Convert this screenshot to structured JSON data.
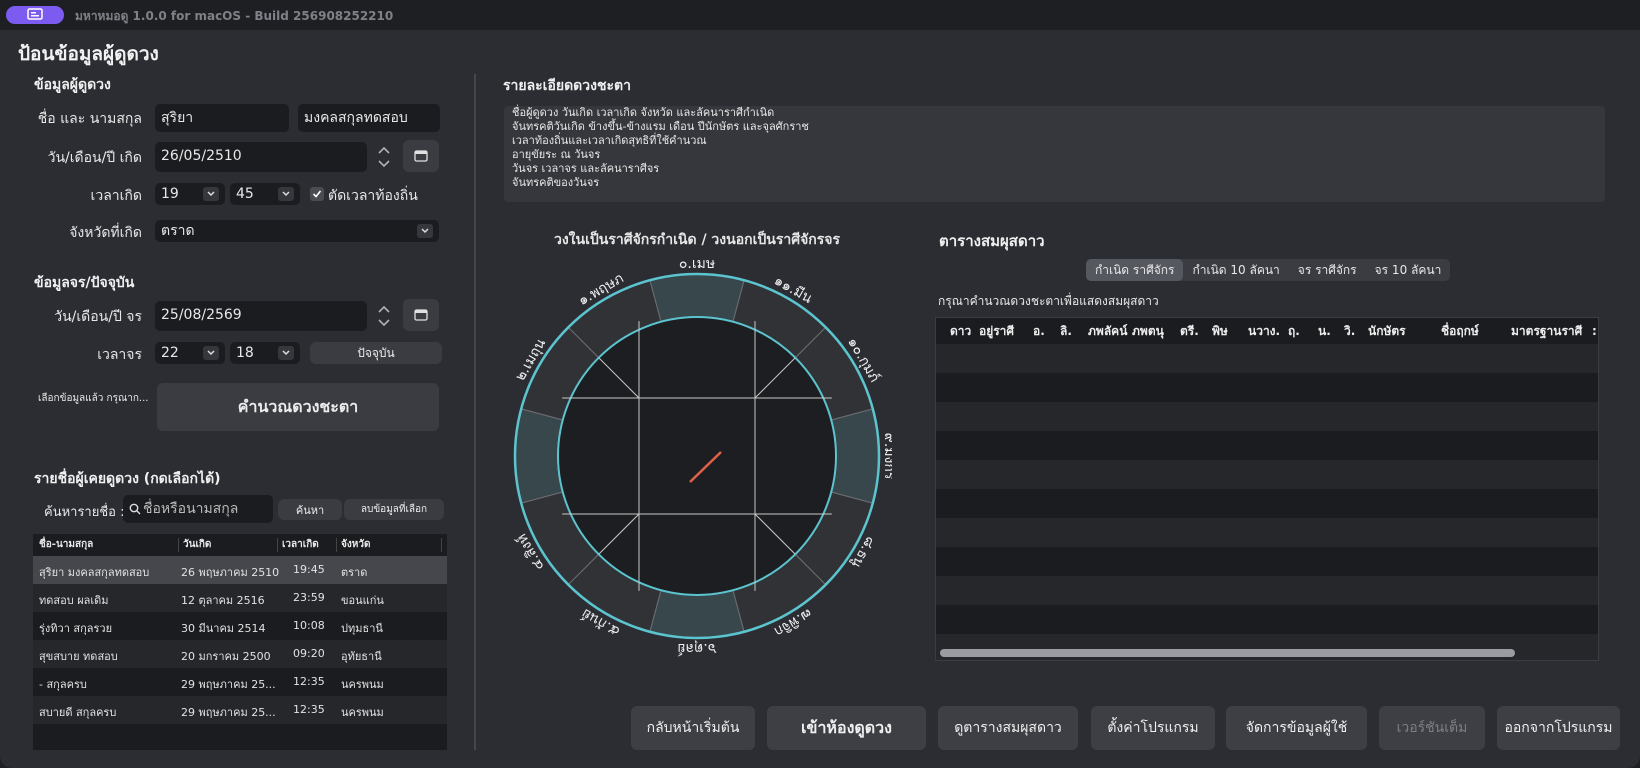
{
  "window": {
    "title": "มหาหมอดู 1.0.0 for macOS - Build 256908252210"
  },
  "page_title": "ป้อนข้อมูลผู้ดูดวง",
  "person": {
    "section": "ข้อมูลผู้ดูดวง",
    "name_label": "ชื่อ และ นามสกุล",
    "first_name": "สุริยา",
    "last_name": "มงคลสกุลทดสอบ",
    "dob_label": "วัน/เดือน/ปี เกิด",
    "dob": "26/05/2510",
    "time_label": "เวลาเกิด",
    "hour": "19",
    "minute": "45",
    "local_time_label": "ตัดเวลาท้องถิ่น",
    "province_label": "จังหวัดที่เกิด",
    "province": "ตราด"
  },
  "transit": {
    "section": "ข้อมูลจร/ปัจจุบัน",
    "date_label": "วัน/เดือน/ปี จร",
    "date": "25/08/2569",
    "time_label": "เวลาจร",
    "hour": "22",
    "minute": "18",
    "now_label": "ปัจจุบัน"
  },
  "hint": "เลือกข้อมูลแล้ว กรุณาก...",
  "calc_button": "คำนวณดวงชะตา",
  "history": {
    "title": "รายชื่อผู้เคยดูดวง (กดเลือกได้)",
    "search_label": "ค้นหารายชื่อ :",
    "search_placeholder": "ชื่อหรือนามสกุล",
    "search_button": "ค้นหา",
    "delete_button": "ลบข้อมูลที่เลือก",
    "columns": [
      "ชื่อ-นามสกุล",
      "วันเกิด",
      "เวลาเกิด",
      "จังหวัด"
    ],
    "rows": [
      [
        "สุริยา มงคลสกุลทดสอบ",
        "26 พฤษภาคม 2510",
        "19:45",
        "ตราด"
      ],
      [
        "ทดสอบ ผลเดิม",
        "12 ตุลาคม 2516",
        "23:59",
        "ขอนแก่น"
      ],
      [
        "รุ่งทิวา สกุลรวย",
        "30 มีนาคม 2514",
        "10:08",
        "ปทุมธานี"
      ],
      [
        "สุขสบาย ทดสอบ",
        "20 มกราคม 2500",
        "09:20",
        "อุทัยธานี"
      ],
      [
        "- สกุลครบ",
        "29 พฤษภาคม 25...",
        "12:35",
        "นครพนม"
      ],
      [
        "สบายดี สกุลครบ",
        "29 พฤษภาคม 25...",
        "12:35",
        "นครพนม"
      ]
    ]
  },
  "details": {
    "title": "รายละเอียดดวงชะตา",
    "lines": [
      "ชื่อผู้ดูดวง วันเกิด เวลาเกิด จังหวัด และลัคนาราศีกำเนิด",
      "จันทรคติวันเกิด ข้างขึ้น-ข้างแรม เดือน ปีนักษัตร และจุลศักราช",
      "เวลาท้องถิ่นและเวลาเกิดสุทธิที่ใช้คำนวณ",
      "อายุขัยระ ณ วันจร",
      "วันจร เวลาจร และลัคนาราศีจร",
      "จันทรคติของวันจร"
    ]
  },
  "chart": {
    "title": "วงในเป็นราศีจักรกำเนิด / วงนอกเป็นราศีจักรจร",
    "signs": [
      "๐.เมษ",
      "๑.พฤษภ",
      "๒.เมถุน",
      "๓.กรกฎ",
      "๔.สิงห์",
      "๕.กันย์",
      "๖.ตุลย์",
      "๗.พิจิก",
      "๘.ธนู",
      "๙.มังกร",
      "๑๐.กุมภ์",
      "๑๑.มีน"
    ]
  },
  "aspects": {
    "title": "ตารางสมผุสดาว",
    "tabs": [
      "กำเนิด ราศีจักร",
      "กำเนิด 10 ลัคนา",
      "จร ราศีจักร",
      "จร 10 ลัคนา"
    ],
    "hint": "กรุณาคำนวณดวงชะตาเพื่อแสดงสมผุสดาว",
    "columns": [
      "ดาว",
      "อยู่ราศี",
      "อ.",
      "ลิ.",
      "ภพลัคน์",
      "ภพตนุ",
      "ตรี.",
      "พิษ",
      "นวาง.",
      "ฤ.",
      "น.",
      "วิ.",
      "นักษัตร",
      "ชื่อฤกษ์",
      "มาตรฐานราศี",
      ":"
    ]
  },
  "bottom": {
    "home": "กลับหน้าเริ่มต้น",
    "enter": "เข้าห้องดูดวง",
    "aspects": "ดูตารางสมผุสดาว",
    "settings": "ตั้งค่าโปรแกรม",
    "users": "จัดการข้อมูลผู้ใช้",
    "full": "เวอร์ชันเต็ม",
    "quit": "ออกจากโปรแกรม"
  },
  "colors": {
    "accent": "#7c5cf0",
    "ring": "#5cc4cf",
    "needle": "#e0614a"
  },
  "icons": {
    "calendar": "calendar-icon",
    "search": "search-icon",
    "check": "checkmark-icon"
  }
}
